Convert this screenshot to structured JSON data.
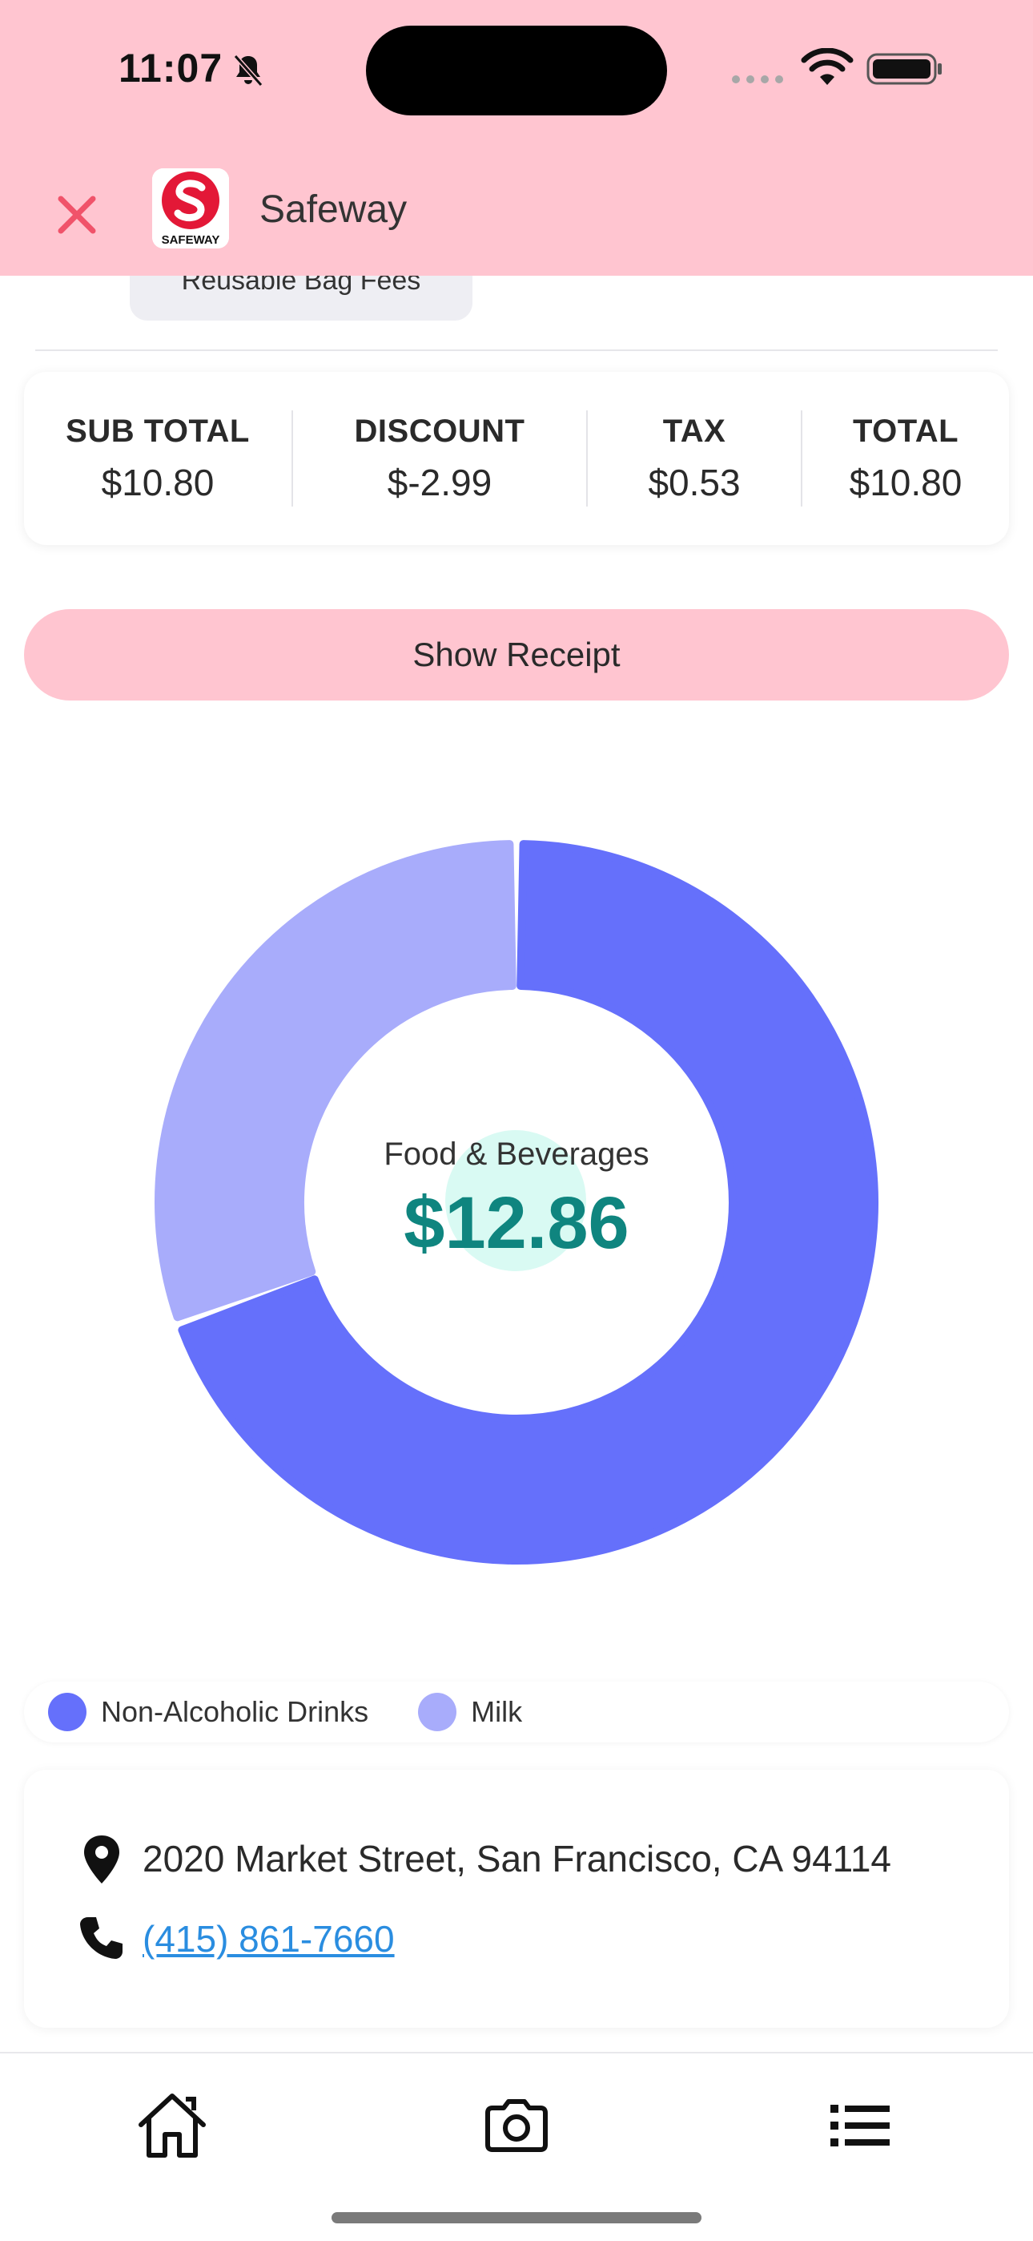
{
  "status_bar": {
    "time": "11:07"
  },
  "header": {
    "store_name": "Safeway",
    "logo_text": "SAFEWAY",
    "close_label": "Close"
  },
  "fee_tag": {
    "label": "Reusable Bag Fees"
  },
  "totals": {
    "subtotal_label": "SUB TOTAL",
    "subtotal_value": "$10.80",
    "discount_label": "DISCOUNT",
    "discount_value": "$-2.99",
    "tax_label": "TAX",
    "tax_value": "$0.53",
    "total_label": "TOTAL",
    "total_value": "$10.80"
  },
  "receipt_button": {
    "label": "Show Receipt"
  },
  "chart": {
    "center_title": "Food & Beverages",
    "center_value": "$12.86"
  },
  "chart_data": {
    "type": "pie",
    "series": [
      {
        "name": "Non-Alcoholic Drinks",
        "value": 0.695,
        "color": "#6570fb"
      },
      {
        "name": "Milk",
        "value": 0.305,
        "color": "#a8acfb"
      }
    ]
  },
  "legend": {
    "items": [
      {
        "label": "Non-Alcoholic Drinks",
        "color": "#6570fb"
      },
      {
        "label": "Milk",
        "color": "#a8acfb"
      }
    ]
  },
  "info": {
    "address": "2020 Market Street, San Francisco, CA 94114",
    "phone": "(415) 861-7660"
  },
  "tabbar": {
    "icons": [
      "home-icon",
      "camera-icon",
      "list-icon"
    ]
  },
  "colors": {
    "header_bg": "#ffc5d0",
    "accent_teal": "#0f857f",
    "link": "#2a8de0",
    "close": "#f0536a"
  }
}
